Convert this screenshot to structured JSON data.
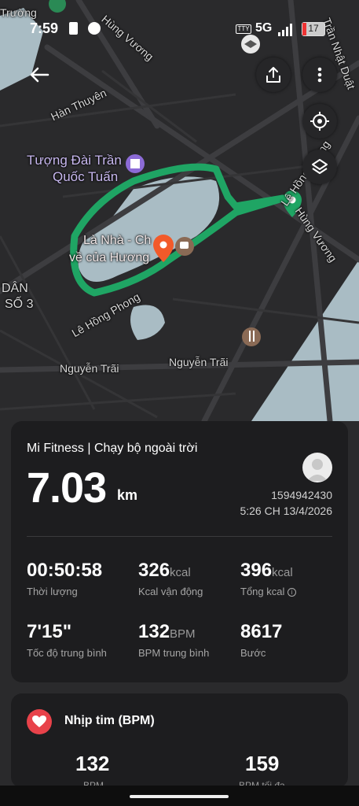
{
  "status": {
    "time": "7:59",
    "network": "5G",
    "battery": "17"
  },
  "map": {
    "labels": {
      "hung_vuong_top": "Hùng Vương",
      "tran_nhat_duat": "Trần Nhật Duật",
      "han_thuyen": "Hàn Thuyên",
      "tuong_dai_1": "Tượng Đài Trần",
      "tuong_dai_2": "Quốc Tuấn",
      "le_hong_phong_right": "Lê Hồng Phong",
      "hung_vuong_right": "Hùng Vương",
      "la_nha_1": "Là Nhà - Ch",
      "la_nha_2": "về của Hương",
      "dan_1": "DÂN",
      "dan_2": "SỐ 3",
      "le_hong_phong_left": "Lê Hồng Phong",
      "nguyen_trai_1": "Nguyễn Trãi",
      "nguyen_trai_2": "Nguyễn Trãi",
      "truong_fragment": "Trường"
    },
    "route_color": "#1fa564",
    "lake_color": "#a9bcc4"
  },
  "actions": {
    "back_icon": "arrow-left-icon",
    "share_icon": "share-icon",
    "more_icon": "more-vertical-icon",
    "locate_icon": "locate-icon",
    "layers_icon": "layers-icon"
  },
  "summary": {
    "title": "Mi Fitness | Chạy bộ ngoài trời",
    "distance": "7.03",
    "distance_unit": "km",
    "user_id": "1594942430",
    "datetime": "5:26 CH 13/4/2026",
    "stats": [
      {
        "value": "00:50:58",
        "unit": "",
        "label": "Thời lượng"
      },
      {
        "value": "326",
        "unit": "kcal",
        "label": "Kcal vận động"
      },
      {
        "value": "396",
        "unit": "kcal",
        "label": "Tổng kcal"
      },
      {
        "value": "7'15\"",
        "unit": "",
        "label": "Tốc độ trung bình"
      },
      {
        "value": "132",
        "unit": "BPM",
        "label": "BPM trung bình"
      },
      {
        "value": "8617",
        "unit": "",
        "label": "Bước"
      }
    ]
  },
  "heart_rate": {
    "title": "Nhịp tim (BPM)",
    "avg_value": "132",
    "avg_label": "BPM",
    "max_value": "159",
    "max_label": "BPM tối đa"
  }
}
